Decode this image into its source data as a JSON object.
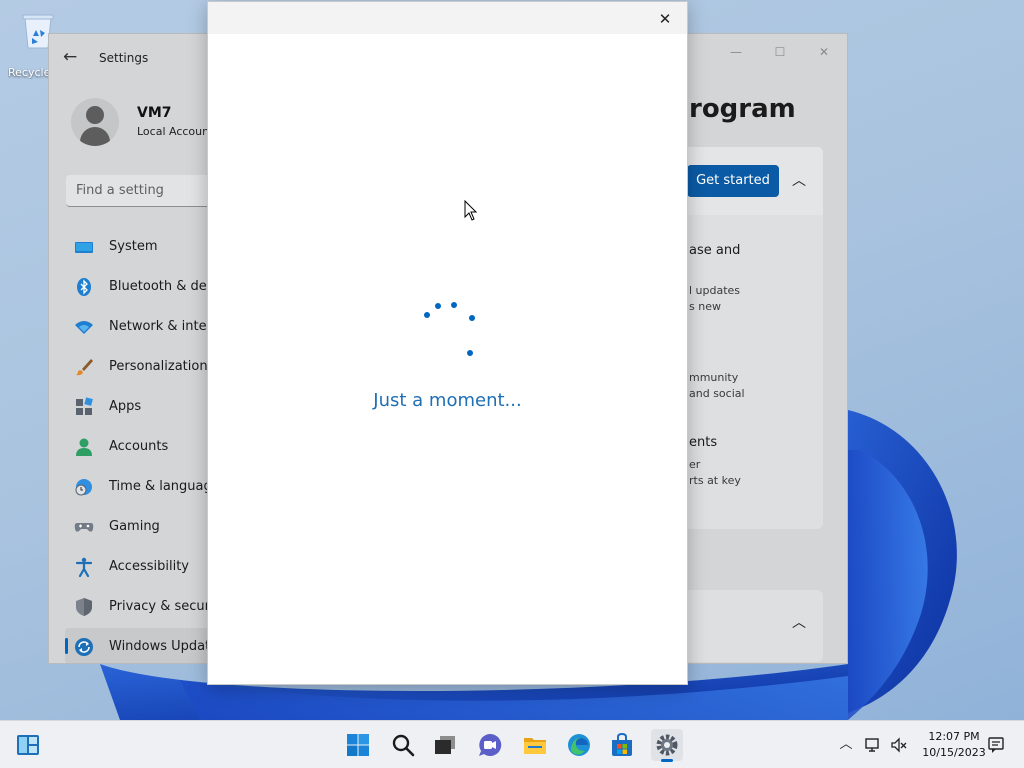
{
  "desktop": {
    "recycle_bin_label": "Recycle Bin"
  },
  "settings": {
    "title": "Settings",
    "user": {
      "name": "VM7",
      "account_type": "Local Account"
    },
    "search_placeholder": "Find a setting",
    "nav": [
      {
        "label": "System",
        "icon": "monitor-icon"
      },
      {
        "label": "Bluetooth & devices",
        "icon": "bluetooth-icon"
      },
      {
        "label": "Network & internet",
        "icon": "wifi-icon"
      },
      {
        "label": "Personalization",
        "icon": "brush-icon"
      },
      {
        "label": "Apps",
        "icon": "apps-icon"
      },
      {
        "label": "Accounts",
        "icon": "person-icon"
      },
      {
        "label": "Time & language",
        "icon": "globe-clock-icon"
      },
      {
        "label": "Gaming",
        "icon": "gamepad-icon"
      },
      {
        "label": "Accessibility",
        "icon": "accessibility-icon"
      },
      {
        "label": "Privacy & security",
        "icon": "shield-icon"
      },
      {
        "label": "Windows Update",
        "icon": "sync-icon",
        "active": true
      }
    ],
    "main": {
      "heading_partial": "rogram",
      "get_started_label": "Get started",
      "rows": [
        {
          "title": "ase and",
          "sub1": "",
          "sub2": ""
        },
        {
          "title": "",
          "sub1": "l updates",
          "sub2": "s new"
        },
        {
          "title": "",
          "sub1": "mmunity",
          "sub2": "and social"
        },
        {
          "title": "ents",
          "sub1": "er",
          "sub2": "rts at key"
        }
      ]
    }
  },
  "dialog": {
    "message": "Just a moment..."
  },
  "taskbar": {
    "apps": [
      "widgets-icon",
      "start-icon",
      "search-icon",
      "task-view-icon",
      "teams-chat-icon",
      "file-explorer-icon",
      "edge-icon",
      "store-icon",
      "settings-gear-icon"
    ],
    "time": "12:07 PM",
    "date": "10/15/2023"
  },
  "colors": {
    "accent": "#0067c0",
    "button_blue": "#0a5aa5",
    "message_blue": "#1f6fb6"
  }
}
